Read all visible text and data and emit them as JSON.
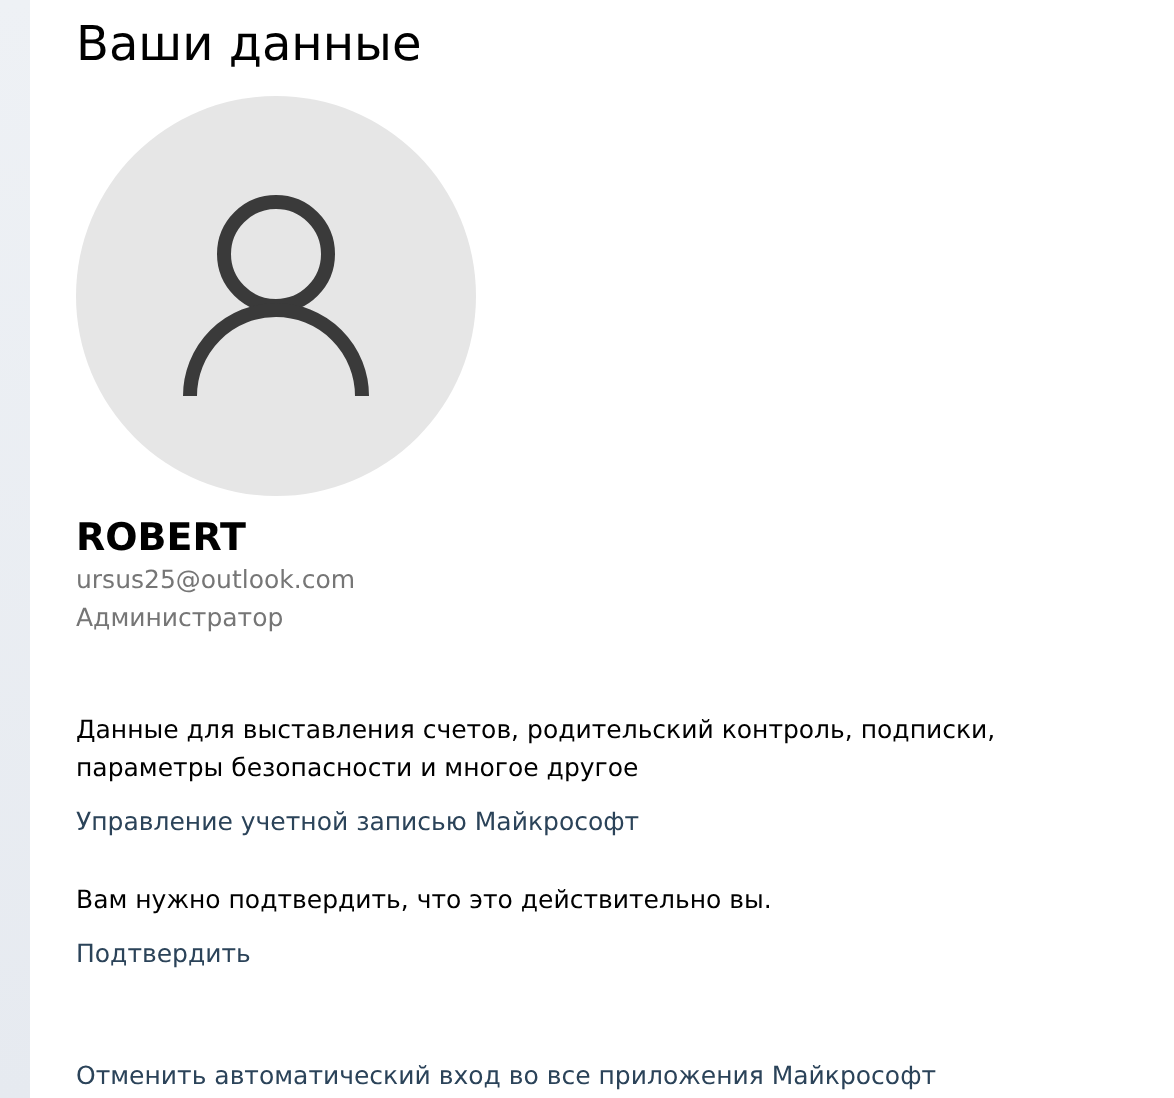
{
  "title": "Ваши данные",
  "account": {
    "name": "ROBERT",
    "email": "ursus25@outlook.com",
    "role": "Администратор"
  },
  "sections": [
    {
      "text": "Данные для выставления счетов, родительский контроль, подписки, параметры безопасности и многое другое",
      "link": "Управление учетной записью Майкрософт"
    },
    {
      "text": "Вам нужно подтвердить, что это действительно вы.",
      "link": "Подтвердить"
    }
  ],
  "footer_link": "Отменить автоматический вход во все приложения Майкрософт"
}
